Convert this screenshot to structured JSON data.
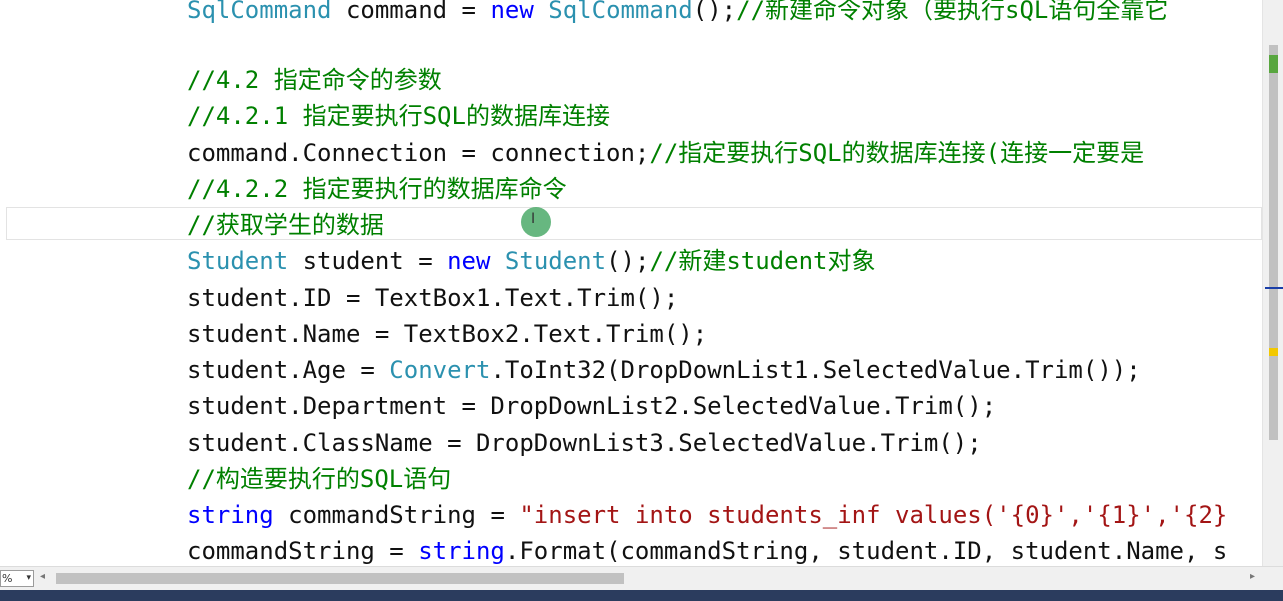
{
  "code": {
    "line1": {
      "type": "SqlCommand",
      "ident": " command = ",
      "kw": "new",
      "type2": "SqlCommand",
      "rest": "();",
      "comment": "//新建命令对象（要执行sQL语句全靠它"
    },
    "line2": {
      "comment": "//4.2 指定命令的参数"
    },
    "line3": {
      "comment": "//4.2.1 指定要执行SQL的数据库连接"
    },
    "line4": {
      "code": "command.Connection = connection;",
      "comment": "//指定要执行SQL的数据库连接(连接一定要是"
    },
    "line5": {
      "comment": "//4.2.2 指定要执行的数据库命令"
    },
    "line6": {
      "comment": "//获取学生的数据"
    },
    "line7": {
      "type": "Student",
      "ident": " student = ",
      "kw": "new",
      "type2": "Student",
      "rest": "();",
      "comment": "//新建student对象"
    },
    "line8": {
      "code": "student.ID = TextBox1.Text.Trim();"
    },
    "line9": {
      "code": "student.Name = TextBox2.Text.Trim();"
    },
    "line10": {
      "pre": "student.Age = ",
      "type": "Convert",
      "rest": ".ToInt32(DropDownList1.SelectedValue.Trim());"
    },
    "line11": {
      "code": "student.Department = DropDownList2.SelectedValue.Trim();"
    },
    "line12": {
      "code": "student.ClassName = DropDownList3.SelectedValue.Trim();"
    },
    "line13": {
      "comment": "//构造要执行的SQL语句"
    },
    "line14": {
      "kw": "string",
      "ident": " commandString = ",
      "str": "\"insert into students_inf values('{0}','{1}','{2}"
    },
    "line15": {
      "pre": "commandString = ",
      "kw": "string",
      "rest": ".Format(commandString, student.ID, student.Name, s"
    }
  },
  "editor": {
    "zoom_value": "%",
    "zoom_arrow": "▾",
    "hscroll_left": "◂",
    "hscroll_right": "▸",
    "ibeam": "I"
  },
  "colors": {
    "comment": "#008000",
    "keyword": "#0000ff",
    "type": "#2b91af",
    "string": "#a31515",
    "status_bar": "#2b3c5e"
  }
}
